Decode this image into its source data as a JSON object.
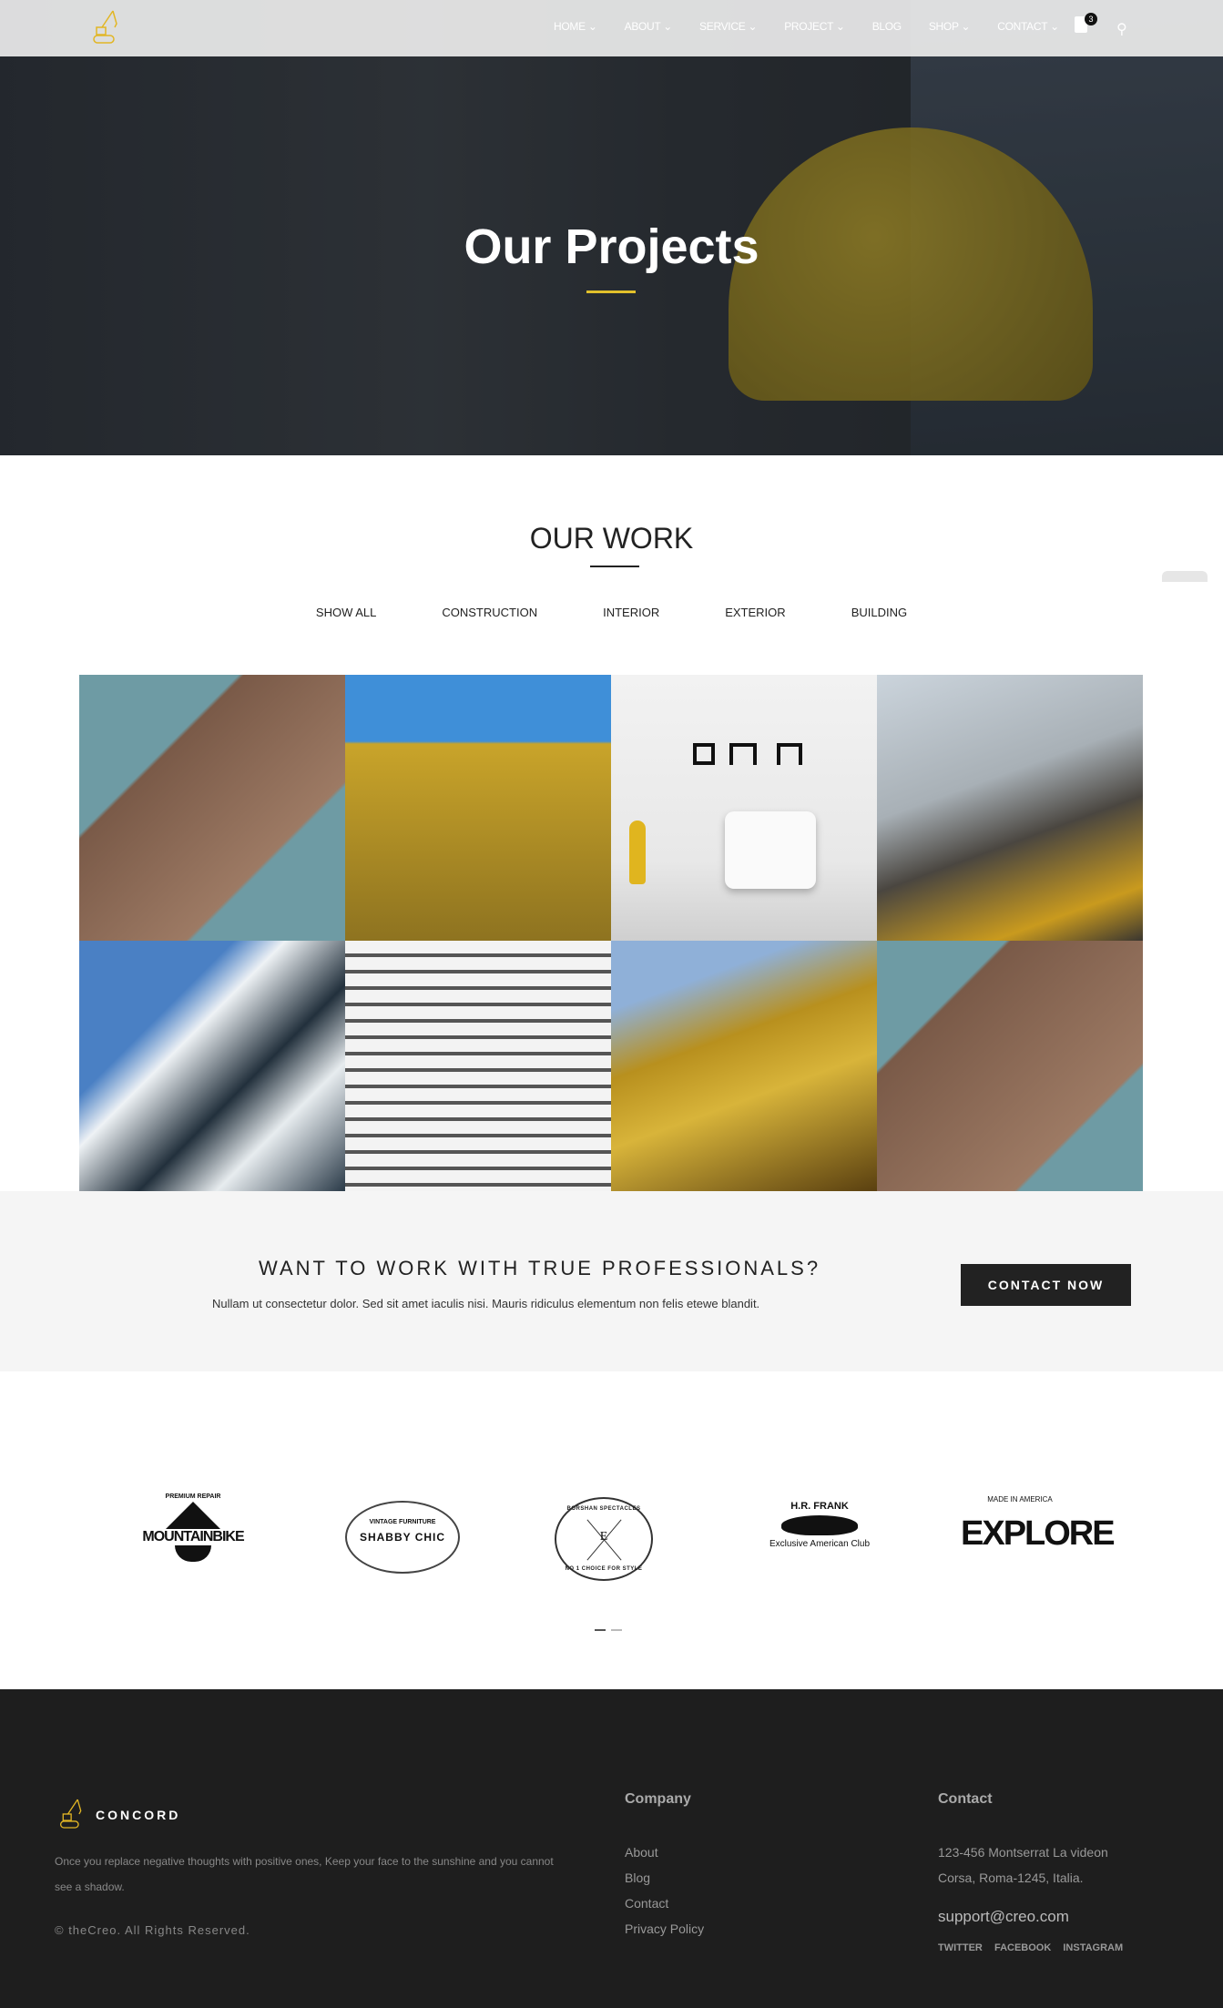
{
  "header": {
    "nav": [
      {
        "label": "HOME",
        "dropdown": true
      },
      {
        "label": "ABOUT",
        "dropdown": true
      },
      {
        "label": "SERVICE",
        "dropdown": true
      },
      {
        "label": "PROJECT",
        "dropdown": true
      },
      {
        "label": "BLOG",
        "dropdown": false
      },
      {
        "label": "SHOP",
        "dropdown": true
      },
      {
        "label": "CONTACT",
        "dropdown": true
      }
    ],
    "cart_count": "3",
    "icons": [
      "excavator-logo-icon",
      "cart-icon",
      "search-icon"
    ],
    "accent": "#e2c12b"
  },
  "hero": {
    "title": "Our Projects"
  },
  "work": {
    "title": "OUR WORK",
    "filters": [
      "SHOW ALL",
      "CONSTRUCTION",
      "INTERIOR",
      "EXTERIOR",
      "BUILDING"
    ],
    "projects": [
      "flatiron-building",
      "construction-workers-scaffold",
      "white-armchair-interior",
      "yellow-excavator",
      "modern-balcony-building",
      "white-balconies-tower",
      "golden-glass-facade",
      "flatiron-building"
    ]
  },
  "cta": {
    "heading": "WANT TO WORK WITH TRUE PROFESSIONALS?",
    "text": "Nullam ut consectetur dolor. Sed sit amet iaculis nisi. Mauris ridiculus elementum non felis etewe blandit.",
    "button": "CONTACT NOW"
  },
  "clients": [
    {
      "name": "MOUNTAINBIKE",
      "sub": "PREMIUM REPAIR"
    },
    {
      "name": "SHABBY CHIC",
      "sub": "VINTAGE FURNITURE"
    },
    {
      "name": "BORSHAN SPECTACLES",
      "sub": "NO 1 CHOICE FOR STYLE"
    },
    {
      "name": "H.R. FRANK",
      "sub": "Exclusive American Club"
    },
    {
      "name": "EXPLORE",
      "sub": "MADE IN AMERICA"
    }
  ],
  "footer": {
    "brand": "CONCORD",
    "description": "Once you replace negative thoughts with positive ones, Keep your face to the sunshine and you cannot see a shadow.",
    "copyright": "© theCreo. All Rights Reserved.",
    "company_title": "Company",
    "company_links": [
      "About",
      "Blog",
      "Contact",
      "Privacy Policy"
    ],
    "contact_title": "Contact",
    "address_line1": "123-456 Montserrat La videon",
    "address_line2": "Corsa, Roma-1245, Italia.",
    "email": "support@creo.com",
    "social": [
      "TWITTER",
      "FACEBOOK",
      "INSTAGRAM"
    ]
  }
}
